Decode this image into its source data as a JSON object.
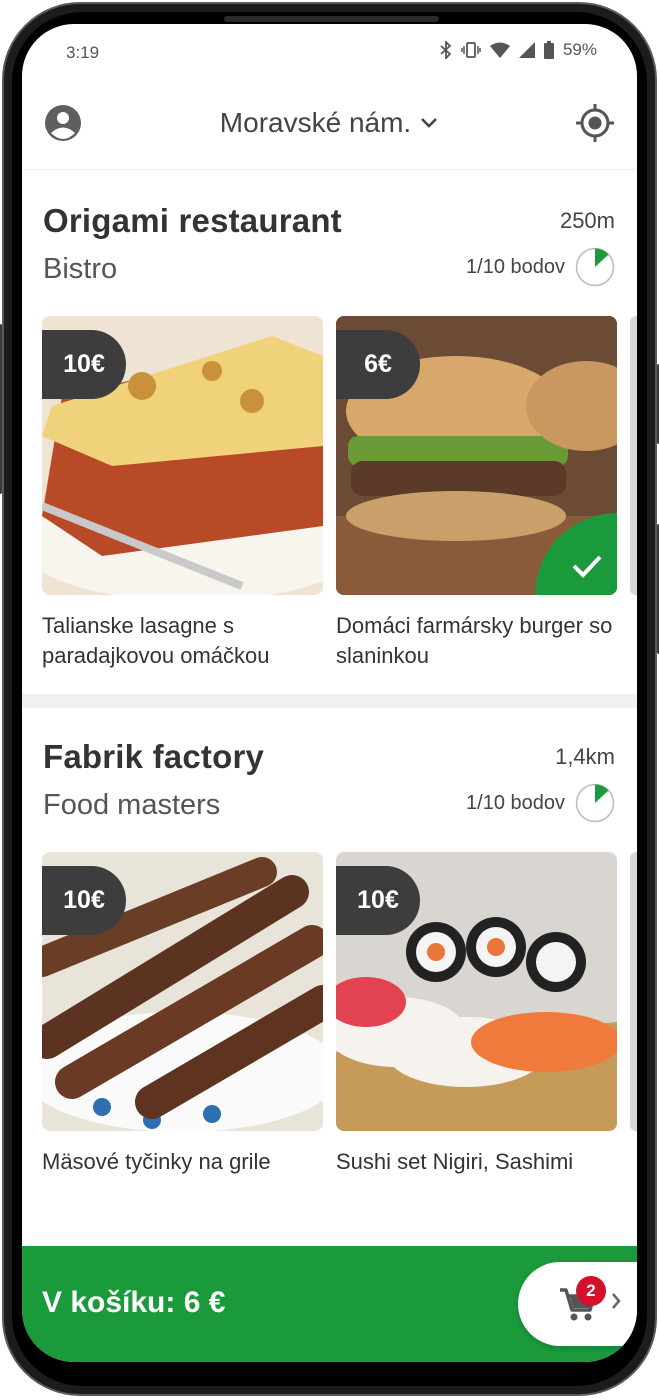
{
  "status_bar": {
    "time": "3:19",
    "battery": "59%",
    "icons": [
      "bluetooth-icon",
      "vibrate-icon",
      "wifi-icon",
      "signal-icon",
      "battery-icon"
    ]
  },
  "header": {
    "location": "Moravské nám.",
    "profile_icon": "account-icon",
    "locate_icon": "gps-target-icon",
    "dropdown_icon": "chevron-down-icon"
  },
  "restaurants": [
    {
      "name": "Origami restaurant",
      "type": "Bistro",
      "distance": "250m",
      "points": "1/10 bodov",
      "points_fraction": 0.1,
      "dishes": [
        {
          "price": "10€",
          "title": "Talianske lasagne s paradajkovou omáčkou",
          "selected": false
        },
        {
          "price": "6€",
          "title": "Domáci farmársky burger so slaninkou",
          "selected": true
        }
      ]
    },
    {
      "name": "Fabrik factory",
      "type": "Food masters",
      "distance": "1,4km",
      "points": "1/10 bodov",
      "points_fraction": 0.1,
      "dishes": [
        {
          "price": "10€",
          "title": "Mäsové tyčinky na grile",
          "selected": false
        },
        {
          "price": "10€",
          "title": "Sushi set Nigiri, Sashimi",
          "selected": false
        }
      ]
    }
  ],
  "cart": {
    "label": "V košíku: 6 €",
    "count": "2",
    "icon": "cart-icon"
  },
  "colors": {
    "accent": "#1b9a3c",
    "badge": "#d3112d",
    "price_tag": "#3d3d3d"
  }
}
